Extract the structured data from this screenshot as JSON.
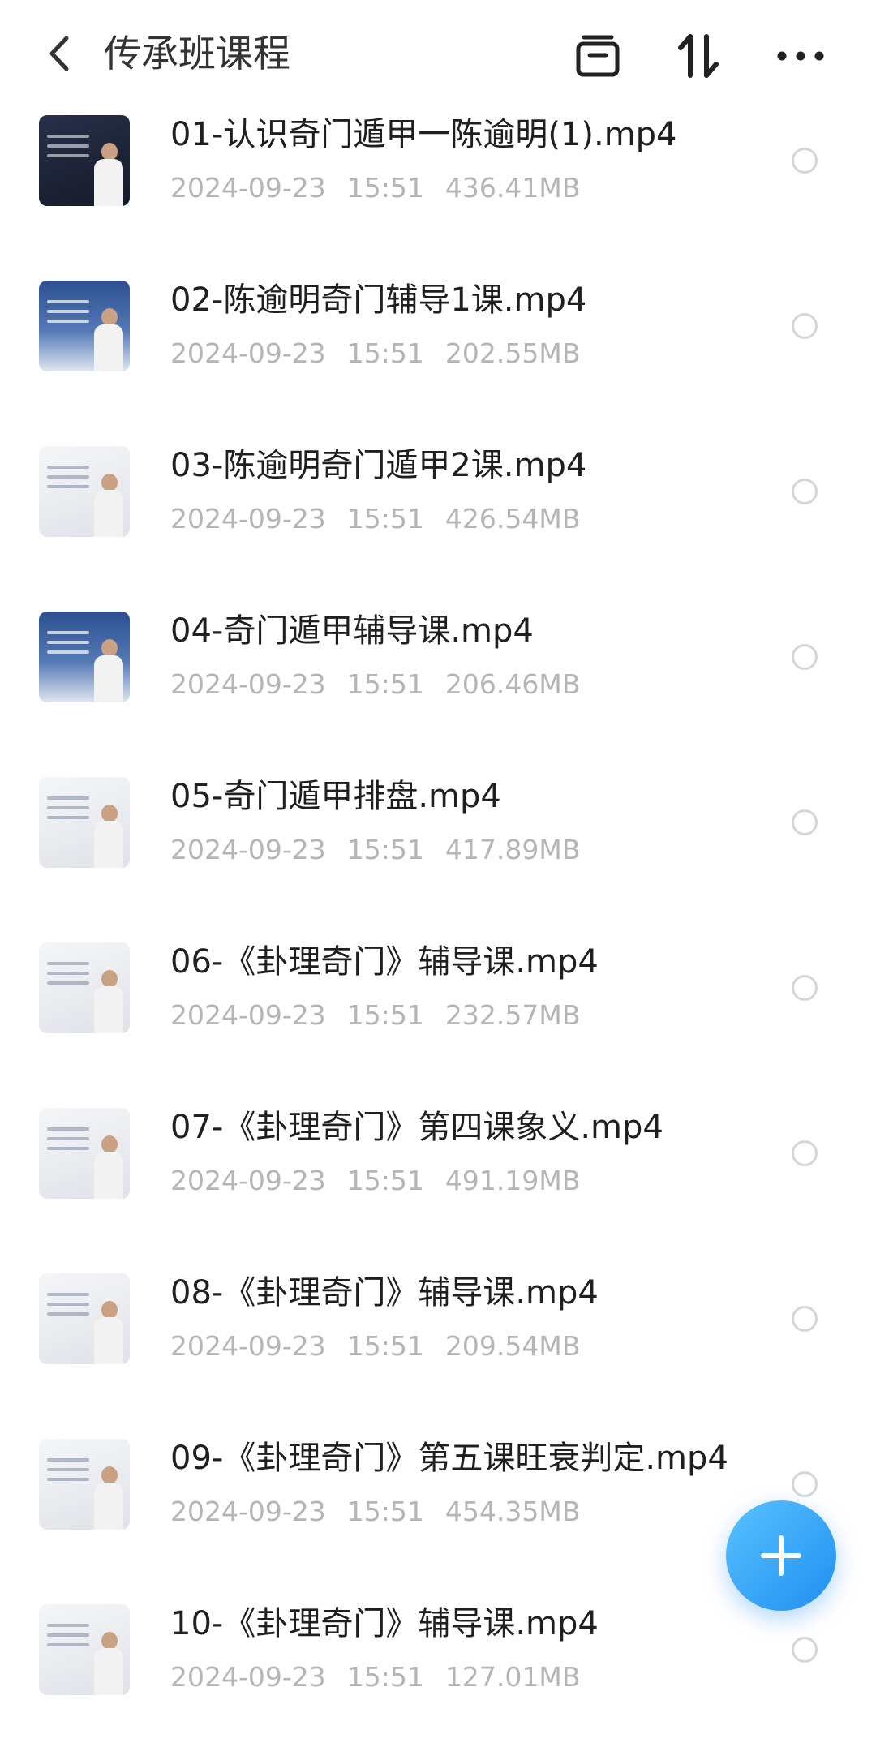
{
  "header": {
    "title": "传承班课程",
    "icons": [
      "back-icon",
      "archive-box-icon",
      "sort-icon",
      "more-icon"
    ]
  },
  "files": [
    {
      "name": "01-认识奇门遁甲一陈逾明(1).mp4",
      "date": "2024-09-23",
      "time": "15:51",
      "size": "436.41MB",
      "thumb": "dark"
    },
    {
      "name": "02-陈逾明奇门辅导1课.mp4",
      "date": "2024-09-23",
      "time": "15:51",
      "size": "202.55MB",
      "thumb": "blue"
    },
    {
      "name": "03-陈逾明奇门遁甲2课.mp4",
      "date": "2024-09-23",
      "time": "15:51",
      "size": "426.54MB",
      "thumb": "light"
    },
    {
      "name": "04-奇门遁甲辅导课.mp4",
      "date": "2024-09-23",
      "time": "15:51",
      "size": "206.46MB",
      "thumb": "blue"
    },
    {
      "name": "05-奇门遁甲排盘.mp4",
      "date": "2024-09-23",
      "time": "15:51",
      "size": "417.89MB",
      "thumb": "light"
    },
    {
      "name": "06-《卦理奇门》辅导课.mp4",
      "date": "2024-09-23",
      "time": "15:51",
      "size": "232.57MB",
      "thumb": "light"
    },
    {
      "name": "07-《卦理奇门》第四课象义.mp4",
      "date": "2024-09-23",
      "time": "15:51",
      "size": "491.19MB",
      "thumb": "light"
    },
    {
      "name": "08-《卦理奇门》辅导课.mp4",
      "date": "2024-09-23",
      "time": "15:51",
      "size": "209.54MB",
      "thumb": "light"
    },
    {
      "name": "09-《卦理奇门》第五课旺衰判定.mp4",
      "date": "2024-09-23",
      "time": "15:51",
      "size": "454.35MB",
      "thumb": "light"
    },
    {
      "name": "10-《卦理奇门》辅导课.mp4",
      "date": "2024-09-23",
      "time": "15:51",
      "size": "127.01MB",
      "thumb": "light"
    }
  ],
  "fab": {
    "icon": "plus-icon"
  },
  "colors": {
    "accent": "#2a9bf5",
    "text": "#1f1f1f",
    "meta": "#b5b5b5"
  }
}
